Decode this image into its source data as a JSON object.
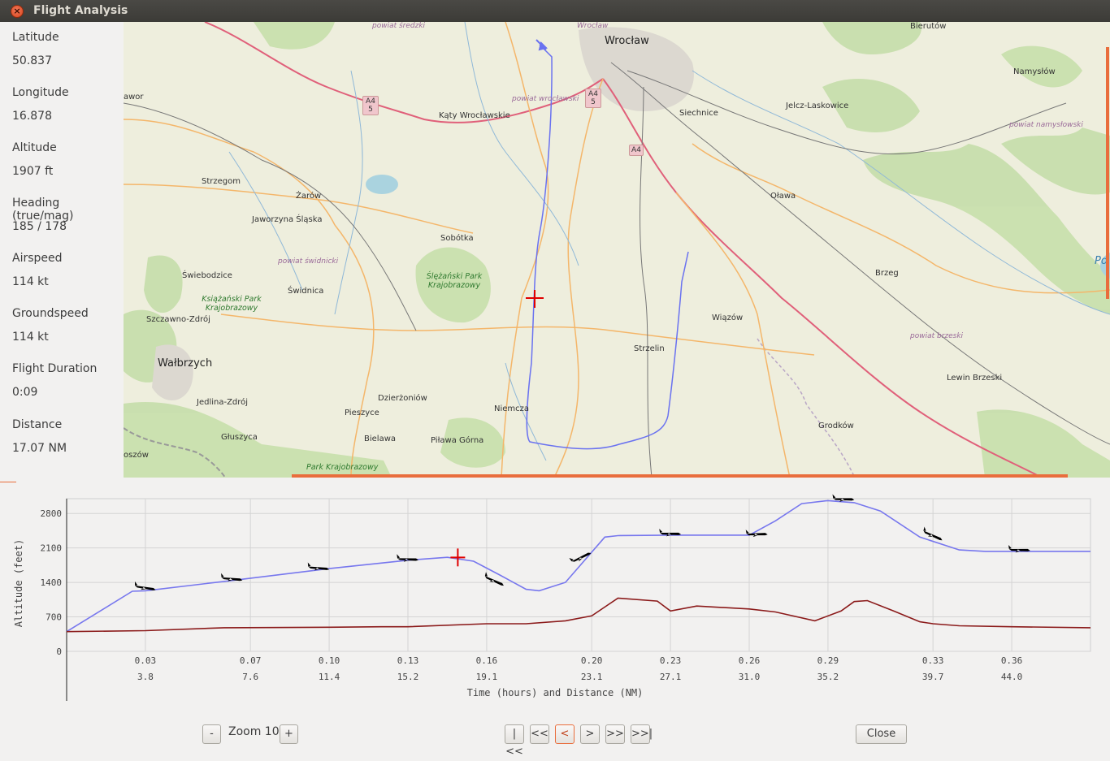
{
  "window": {
    "title": "Flight Analysis"
  },
  "info": [
    {
      "label": "Latitude",
      "value": "50.837"
    },
    {
      "label": "Longitude",
      "value": "16.878"
    },
    {
      "label": "Altitude",
      "value": "1907 ft"
    },
    {
      "label": "Heading (true/mag)",
      "value": "185 / 178"
    },
    {
      "label": "Airspeed",
      "value": "114 kt"
    },
    {
      "label": "Groundspeed",
      "value": "114 kt"
    },
    {
      "label": "Flight Duration",
      "value": "0:09"
    },
    {
      "label": "Distance",
      "value": "17.07 NM"
    }
  ],
  "map": {
    "cities": [
      "Wrocław",
      "Wałbrzych"
    ],
    "towns": [
      "Bierutów",
      "Namysłów",
      "Jelcz-Laskowice",
      "Siechnice",
      "Kąty Wrocławskie",
      "Strzegom",
      "Żarów",
      "Jaworzyna Śląska",
      "Sobótka",
      "Oława",
      "Brzeg",
      "Świebodzice",
      "Świdnica",
      "Szczawno-Zdrój",
      "Wiązów",
      "Strzelin",
      "Lewin Brzeski",
      "Dzierżoniów",
      "Niemcza",
      "Pieszyce",
      "Bielawa",
      "Piława Górna",
      "Grodków",
      "Jedlina-Zdrój",
      "Głuszyca",
      "awor",
      "oszów"
    ],
    "regions": [
      "powiat średzki",
      "powiat wrocławski",
      "powiat świdnicki",
      "powiat namysłowski",
      "powiat brzeski",
      "Wrocław",
      "Po"
    ],
    "parks": [
      "Ślężański Park Krajobrazowy",
      "Książański Park Krajobrazowy",
      "Park Krajobrazowy"
    ],
    "shields": [
      "A4 5",
      "A4 5",
      "A4"
    ]
  },
  "chart_data": {
    "type": "line",
    "ylabel": "Altitude (feet)",
    "xlabel": "Time (hours) and Distance (NM)",
    "yticks": [
      "0",
      "700",
      "1400",
      "2100",
      "2800"
    ],
    "xticks_time": [
      "0.03",
      "0.07",
      "0.10",
      "0.13",
      "0.16",
      "0.20",
      "0.23",
      "0.26",
      "0.29",
      "0.33",
      "0.36"
    ],
    "xticks_dist": [
      "3.8",
      "7.6",
      "11.4",
      "15.2",
      "19.1",
      "23.1",
      "27.1",
      "31.0",
      "35.2",
      "39.7",
      "44.0"
    ],
    "ylim": [
      0,
      3100
    ],
    "xlim": [
      0.0,
      0.39
    ],
    "series": [
      {
        "color": "#7777ee",
        "x": [
          0.0,
          0.025,
          0.03,
          0.06,
          0.1,
          0.13,
          0.145,
          0.155,
          0.165,
          0.175,
          0.18,
          0.19,
          0.205,
          0.21,
          0.23,
          0.26,
          0.27,
          0.28,
          0.29,
          0.3,
          0.31,
          0.325,
          0.34,
          0.35,
          0.39
        ],
        "y": [
          400,
          1220,
          1230,
          1420,
          1680,
          1850,
          1910,
          1830,
          1550,
          1260,
          1230,
          1400,
          2320,
          2350,
          2360,
          2360,
          2650,
          3000,
          3060,
          3020,
          2850,
          2320,
          2060,
          2030,
          2030
        ]
      },
      {
        "color": "#8b1a1a",
        "x": [
          0.0,
          0.03,
          0.06,
          0.1,
          0.12,
          0.13,
          0.16,
          0.175,
          0.19,
          0.2,
          0.205,
          0.21,
          0.225,
          0.23,
          0.24,
          0.26,
          0.27,
          0.285,
          0.295,
          0.3,
          0.305,
          0.315,
          0.325,
          0.33,
          0.34,
          0.36,
          0.39
        ],
        "y": [
          400,
          420,
          480,
          490,
          500,
          500,
          560,
          560,
          620,
          720,
          900,
          1080,
          1020,
          820,
          920,
          860,
          800,
          620,
          820,
          1010,
          1030,
          820,
          600,
          560,
          520,
          500,
          480
        ]
      }
    ],
    "markers": [
      {
        "x": 0.03,
        "y": 1300,
        "angle": 10
      },
      {
        "x": 0.063,
        "y": 1480,
        "angle": 6
      },
      {
        "x": 0.096,
        "y": 1700,
        "angle": 6
      },
      {
        "x": 0.13,
        "y": 1880,
        "angle": 3
      },
      {
        "x": 0.163,
        "y": 1440,
        "angle": 25
      },
      {
        "x": 0.196,
        "y": 1920,
        "angle": -25
      },
      {
        "x": 0.23,
        "y": 2400,
        "angle": 2
      },
      {
        "x": 0.263,
        "y": 2390,
        "angle": 0
      },
      {
        "x": 0.296,
        "y": 3100,
        "angle": 2
      },
      {
        "x": 0.33,
        "y": 2360,
        "angle": 25
      },
      {
        "x": 0.363,
        "y": 2070,
        "angle": 2
      }
    ],
    "cursor": {
      "x": 0.149,
      "y": 1907
    }
  },
  "controls": {
    "zoom_out": "-",
    "zoom_label": "Zoom 10",
    "zoom_in": "+",
    "first": "|<<",
    "back_fast": "<<",
    "back": "<",
    "forward": ">",
    "forward_fast": ">>",
    "last": ">>|",
    "close": "Close"
  }
}
